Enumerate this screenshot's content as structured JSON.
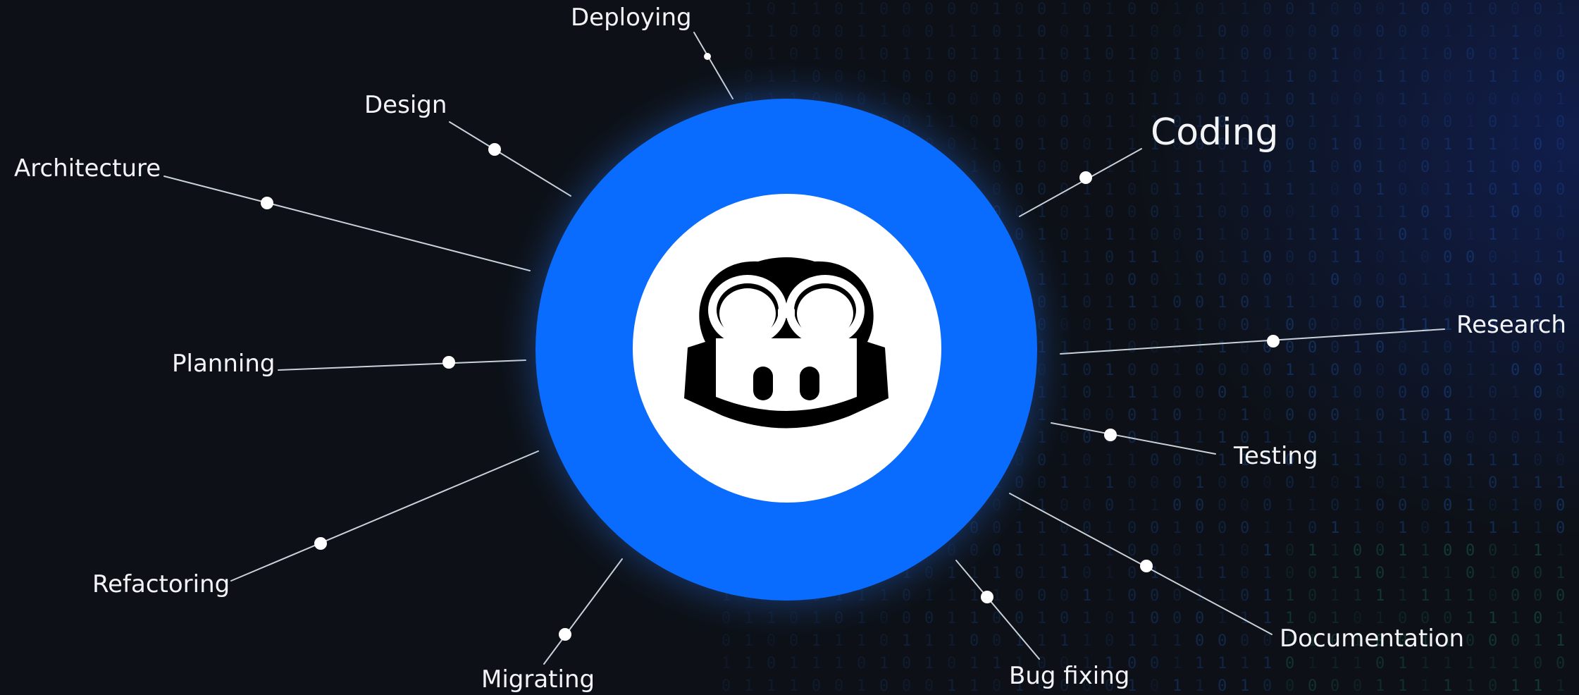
{
  "diagram": {
    "center": {
      "icon": "copilot-goggles-icon",
      "ring_color": "#0a6cff",
      "inner_color": "#ffffff",
      "glyph_color": "#000000"
    },
    "labels": {
      "coding": "Coding",
      "research": "Research",
      "testing": "Testing",
      "documentation": "Documentation",
      "bug_fixing": "Bug fixing",
      "migrating": "Migrating",
      "refactoring": "Refactoring",
      "planning": "Planning",
      "architecture": "Architecture",
      "design": "Design",
      "deploying": "Deploying"
    },
    "colors": {
      "background": "#0d1117",
      "text": "#f2f4f7",
      "connector": "#c9d1d9",
      "matrix_digits": "#1f6feb"
    }
  }
}
